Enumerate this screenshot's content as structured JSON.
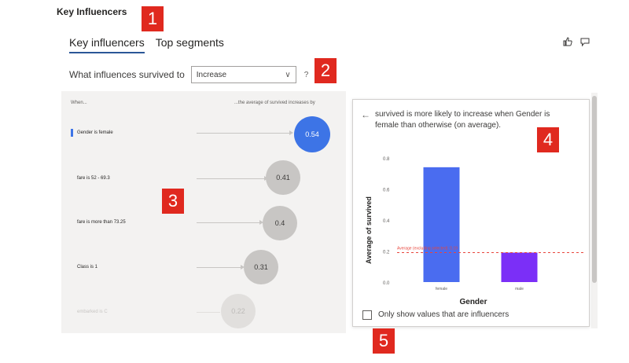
{
  "visual_title": "Key Influencers",
  "markers": [
    "1",
    "2",
    "3",
    "4",
    "5"
  ],
  "tabs": [
    {
      "label": "Key influencers",
      "active": true
    },
    {
      "label": "Top segments",
      "active": false
    }
  ],
  "feedback_icons": [
    "thumbs-up-icon",
    "comment-icon"
  ],
  "question": {
    "label": "What influences survived to",
    "selected_value": "Increase",
    "help_label": "?"
  },
  "influencers_panel": {
    "when_label": "When...",
    "average_label": "...the average of survived increases by",
    "items": [
      {
        "label": "Gender is female",
        "value": "0.54",
        "selected": true
      },
      {
        "label": "fare is 52 - 69.3",
        "value": "0.41"
      },
      {
        "label": "fare is more than 73.25",
        "value": "0.4"
      },
      {
        "label": "Class is 1",
        "value": "0.31"
      },
      {
        "label": "embarked is C",
        "value": "0.22"
      }
    ]
  },
  "detail_panel": {
    "back_icon": "arrow-left-icon",
    "explanation_line1": "survived is more likely to increase when Gender is",
    "explanation_line2": "female than otherwise (on average).",
    "checkbox_label": "Only show values that are influencers",
    "checkbox_checked": false
  },
  "colors": {
    "selected": "#3d74e6",
    "bar_primary": "#4a6cf0",
    "bar_secondary": "#7b2ff7",
    "reference_line": "#e8453c",
    "marker": "#e0291f"
  },
  "chart_data": {
    "type": "bar",
    "categories": [
      "female",
      "male"
    ],
    "values": [
      0.74,
      0.19
    ],
    "ylabel": "Average of survived",
    "xlabel": "Gender",
    "ylim": [
      0,
      0.8
    ],
    "yticks": [
      "0.0",
      "0.2",
      "0.4",
      "0.6",
      "0.8"
    ],
    "reference_line": {
      "value": 0.19,
      "label": "Average (excluding selected): 0.19"
    },
    "grid": false,
    "legend": "none"
  }
}
